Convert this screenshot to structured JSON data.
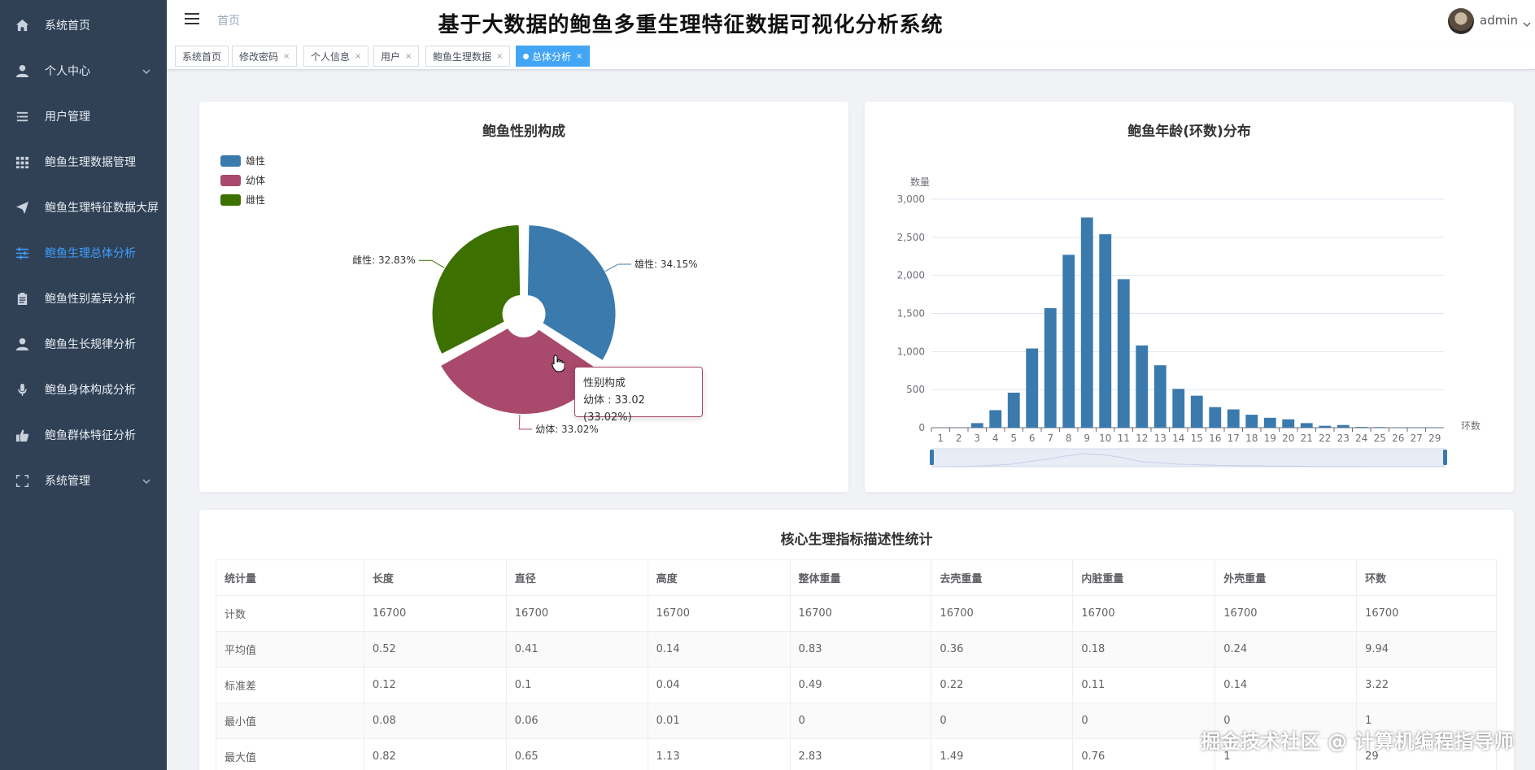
{
  "sidebar": {
    "items": [
      {
        "label": "系统首页",
        "icon": "home-icon"
      },
      {
        "label": "个人中心",
        "icon": "user-icon",
        "has_arrow": true
      },
      {
        "label": "用户管理",
        "icon": "list-icon"
      },
      {
        "label": "鲍鱼生理数据管理",
        "icon": "grid-icon"
      },
      {
        "label": "鲍鱼生理特征数据大屏",
        "icon": "send-icon"
      },
      {
        "label": "鲍鱼生理总体分析",
        "icon": "sliders-icon",
        "active": true
      },
      {
        "label": "鲍鱼性别差异分析",
        "icon": "clipboard-icon"
      },
      {
        "label": "鲍鱼生长规律分析",
        "icon": "user-icon"
      },
      {
        "label": "鲍鱼身体构成分析",
        "icon": "mic-icon"
      },
      {
        "label": "鲍鱼群体特征分析",
        "icon": "like-icon"
      },
      {
        "label": "系统管理",
        "icon": "fullscreen-icon",
        "has_arrow": true
      }
    ]
  },
  "header": {
    "breadcrumb": "首页",
    "title": "基于大数据的鲍鱼多重生理特征数据可视化分析系统",
    "user": "admin"
  },
  "tags": [
    {
      "label": "系统首页",
      "closable": false
    },
    {
      "label": "修改密码",
      "closable": true
    },
    {
      "label": "个人信息",
      "closable": true
    },
    {
      "label": "用户",
      "closable": true
    },
    {
      "label": "鲍鱼生理数据",
      "closable": true
    },
    {
      "label": "总体分析",
      "closable": true,
      "active": true
    }
  ],
  "colors": {
    "sidebar_bg": "#304156",
    "accent": "#409eff",
    "male": "#3b7aad",
    "infant": "#a9496c",
    "female": "#3c7000",
    "bar": "#3b7aad"
  },
  "chart_data": [
    {
      "type": "pie",
      "title": "鲍鱼性别构成",
      "legend_position": "top-left",
      "slices": [
        {
          "name": "雄性",
          "value": 34.15,
          "label": "雄性: 34.15%"
        },
        {
          "name": "幼体",
          "value": 33.02,
          "label": "幼体: 33.02%"
        },
        {
          "name": "雌性",
          "value": 32.83,
          "label": "雌性: 32.83%"
        }
      ],
      "tooltip": {
        "title": "性别构成",
        "text": "幼体 : 33.02 (33.02%)"
      }
    },
    {
      "type": "bar",
      "title": "鲍鱼年龄(环数)分布",
      "xlabel": "环数",
      "ylabel": "数量",
      "ylim": [
        0,
        3000
      ],
      "yticks": [
        "0",
        "500",
        "1,000",
        "1,500",
        "2,000",
        "2,500",
        "3,000"
      ],
      "grid": true,
      "categories": [
        "1",
        "2",
        "3",
        "4",
        "5",
        "6",
        "7",
        "8",
        "9",
        "10",
        "11",
        "12",
        "13",
        "14",
        "15",
        "16",
        "17",
        "18",
        "19",
        "20",
        "21",
        "22",
        "23",
        "24",
        "25",
        "26",
        "27",
        "29"
      ],
      "values": [
        1,
        2,
        60,
        230,
        460,
        1040,
        1570,
        2270,
        2760,
        2540,
        1950,
        1080,
        820,
        510,
        420,
        270,
        240,
        170,
        130,
        110,
        60,
        25,
        35,
        10,
        8,
        5,
        3,
        4
      ]
    }
  ],
  "stats_table": {
    "title": "核心生理指标描述性统计",
    "headers": [
      "统计量",
      "长度",
      "直径",
      "高度",
      "整体重量",
      "去壳重量",
      "内脏重量",
      "外壳重量",
      "环数"
    ],
    "rows": [
      [
        "计数",
        "16700",
        "16700",
        "16700",
        "16700",
        "16700",
        "16700",
        "16700",
        "16700"
      ],
      [
        "平均值",
        "0.52",
        "0.41",
        "0.14",
        "0.83",
        "0.36",
        "0.18",
        "0.24",
        "9.94"
      ],
      [
        "标准差",
        "0.12",
        "0.1",
        "0.04",
        "0.49",
        "0.22",
        "0.11",
        "0.14",
        "3.22"
      ],
      [
        "最小值",
        "0.08",
        "0.06",
        "0.01",
        "0",
        "0",
        "0",
        "0",
        "1"
      ],
      [
        "最大值",
        "0.82",
        "0.65",
        "1.13",
        "2.83",
        "1.49",
        "0.76",
        "1",
        "29"
      ]
    ]
  },
  "watermark": "掘金技术社区 @ 计算机编程指导师"
}
